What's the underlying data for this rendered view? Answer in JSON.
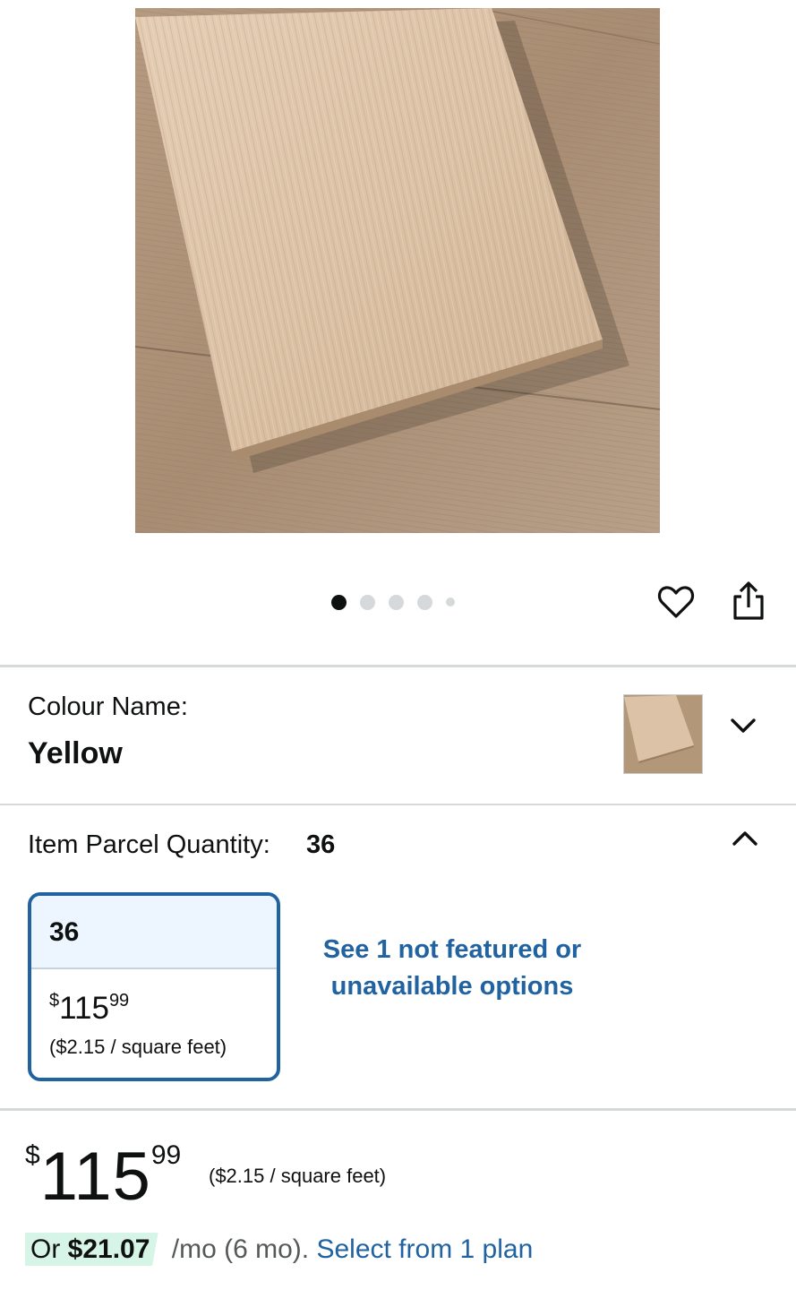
{
  "gallery": {
    "image_count": 5,
    "active_index": 0
  },
  "actions": {
    "wishlist_icon": "heart-icon",
    "share_icon": "share-icon"
  },
  "colour": {
    "label": "Colour Name:",
    "value": "Yellow"
  },
  "quantity": {
    "label": "Item Parcel Quantity:",
    "value": "36",
    "option": {
      "name": "36",
      "price_symbol": "$",
      "price_whole": "115",
      "price_cents": "99",
      "unit_price": "($2.15 / square feet)"
    },
    "not_featured_link": "See 1 not featured or unavailable options"
  },
  "price": {
    "symbol": "$",
    "whole": "115",
    "cents": "99",
    "unit_price": "($2.15 / square feet)"
  },
  "installment": {
    "prefix": "Or ",
    "amount": "$21.07",
    "term": " /mo (6 mo). ",
    "link": "Select from 1 plan"
  },
  "colors": {
    "link_blue": "#2162a1",
    "selected_border": "#2162a1",
    "selected_header_bg": "#edf6ff",
    "installment_highlight": "#d7f5e6",
    "divider": "#d5d9d9"
  }
}
